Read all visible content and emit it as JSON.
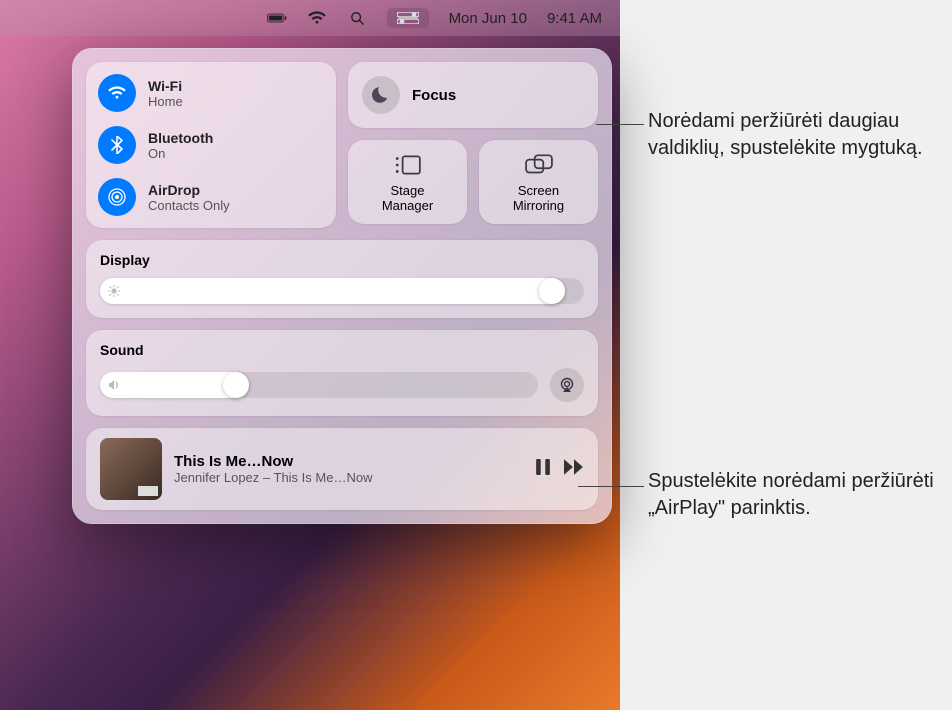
{
  "menubar": {
    "date": "Mon Jun 10",
    "time": "9:41 AM"
  },
  "connectivity": {
    "wifi": {
      "title": "Wi-Fi",
      "sub": "Home"
    },
    "bluetooth": {
      "title": "Bluetooth",
      "sub": "On"
    },
    "airdrop": {
      "title": "AirDrop",
      "sub": "Contacts Only"
    }
  },
  "focus": {
    "label": "Focus"
  },
  "stage": {
    "label": "Stage\nManager"
  },
  "mirror": {
    "label": "Screen\nMirroring"
  },
  "display": {
    "title": "Display",
    "value_pct": 96
  },
  "sound": {
    "title": "Sound",
    "value_pct": 34
  },
  "nowplaying": {
    "title": "This Is Me…Now",
    "artist": "Jennifer Lopez – This Is Me…Now"
  },
  "callouts": {
    "focus_hint": "Norėdami peržiūrėti daugiau valdiklių, spustelėkite mygtuką.",
    "airplay_hint": "Spustelėkite norėdami peržiūrėti „AirPlay\" parinktis."
  }
}
